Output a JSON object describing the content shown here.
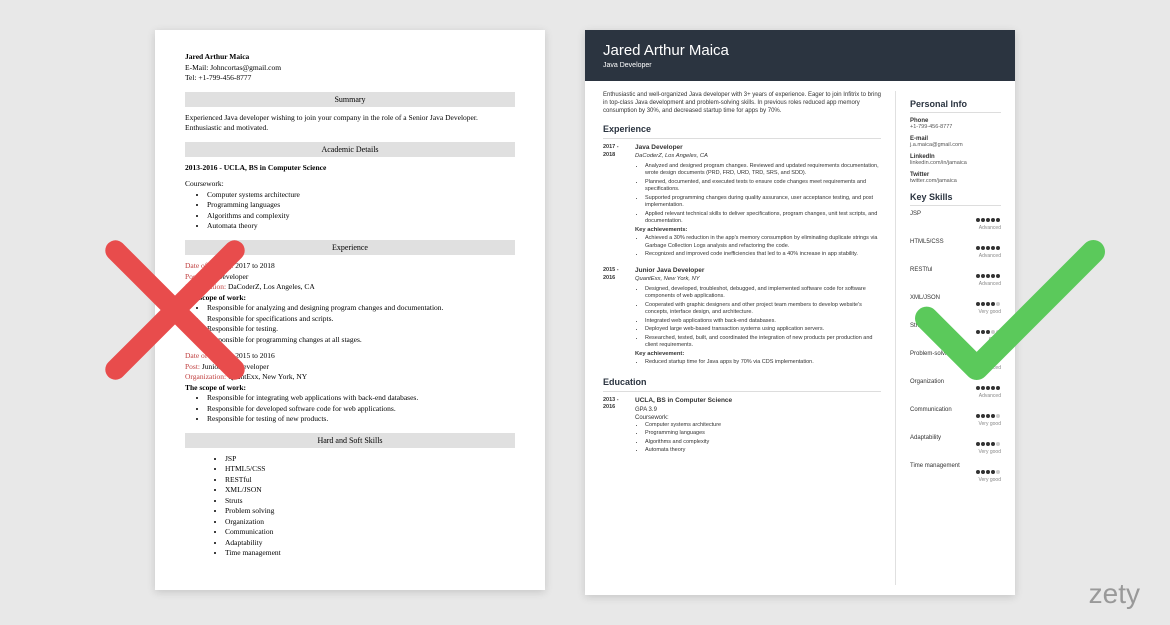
{
  "left": {
    "name": "Jared Arthur Maica",
    "email_lbl": "E-Mail: Johncortas@gmail.com",
    "tel_lbl": "Tel: +1-799-456-8777",
    "s1": "Summary",
    "summary": "Experienced Java developer wishing to join your company in the role of a Senior Java Developer. Enthusiastic and motivated.",
    "s2": "Academic Details",
    "edu": "2013-2016 - UCLA, BS in Computer Science",
    "cw": "Coursework:",
    "courses": [
      "Computer systems architecture",
      "Programming languages",
      "Algorithms and complexity",
      "Automata theory"
    ],
    "s3": "Experience",
    "e1_doj": "Date of Joining:",
    "e1_dates": " 2017 to 2018",
    "e1_post": "Post:",
    "e1_pv": " Java Developer",
    "e1_org": "Organization:",
    "e1_ov": " DaCoderZ, Los Angeles, CA",
    "scope": "The scope of work:",
    "e1_b": [
      "Responsible for analyzing and designing program changes and documentation.",
      "Responsible for specifications and scripts.",
      "Responsible for testing.",
      "Responsible for programming changes at all stages."
    ],
    "e2_doj": "Date of Joining:",
    "e2_dates": " 2015 to 2016",
    "e2_post": "Post:",
    "e2_pv": " Junior Java Developer",
    "e2_org": "Organization:",
    "e2_ov": " QuantExx, New York, NY",
    "e2_b": [
      "Responsible for integrating web applications with back-end databases.",
      "Responsible for developed software code for web applications.",
      "Responsible for testing of new products."
    ],
    "s4": "Hard and Soft Skills",
    "sk": [
      "JSP",
      "HTML5/CSS",
      "RESTful",
      "XML/JSON",
      "Struts",
      "Problem solving",
      "Organization",
      "Communication",
      "Adaptability",
      "Time management"
    ]
  },
  "right": {
    "name": "Jared Arthur Maica",
    "title": "Java Developer",
    "summary": "Enthusiastic and well-organized Java developer with 3+ years of experience. Eager to join Infitrix to bring in top-class Java development and problem-solving skills. In previous roles reduced app memory consumption by 30%, and decreased startup time for apps by 70%.",
    "h_exp": "Experience",
    "h_edu": "Education",
    "h_pi": "Personal Info",
    "h_ks": "Key Skills",
    "jobs": [
      {
        "d1": "2017 -",
        "d2": "2018",
        "title": "Java Developer",
        "org": "DaCoderZ, Los Angeles, CA",
        "bul": [
          "Analyzed and designed program changes. Reviewed and updated requirements documentation, wrote design documents (PRD, FRD, URD, TRD, SRS, and SDD).",
          "Planned, documented, and executed tests to ensure code changes meet requirements and specifications.",
          "Supported programming changes during quality assurance, user acceptance testing, and post implementation.",
          "Applied relevant technical skills to deliver specifications, program changes, unit test scripts, and documentation."
        ],
        "ka": "Key achievements:",
        "ab": [
          "Achieved a 30% reduction in the app's memory consumption by eliminating duplicate strings via Garbage Collection Logs analysis and refactoring the code.",
          "Recognized and improved code inefficiencies that led to a 40% increase in app stability."
        ]
      },
      {
        "d1": "2015 -",
        "d2": "2016",
        "title": "Junior Java Developer",
        "org": "QuantExx, New York, NY",
        "bul": [
          "Designed, developed, troubleshot, debugged, and implemented software code for software components of web applications.",
          "Cooperated with graphic designers and other project team members to develop website's concepts, interface design, and architecture.",
          "Integrated web applications with back-end databases.",
          "Deployed large web-based transaction systems using application servers.",
          "Researched, tested, built, and coordinated the integration of new products per production and client requirements."
        ],
        "ka": "Key achievement:",
        "ab": [
          "Reduced startup time for Java apps by 70% via CDS implementation."
        ]
      }
    ],
    "edu": {
      "d1": "2013 -",
      "d2": "2016",
      "title": "UCLA, BS in Computer Science",
      "gpa": "GPA 3.9",
      "cw": "Coursework:",
      "c": [
        "Computer systems architecture",
        "Programming languages",
        "Algorithms and complexity",
        "Automata theory"
      ]
    },
    "pi": [
      {
        "lbl": "Phone",
        "val": "+1-799-456-8777"
      },
      {
        "lbl": "E-mail",
        "val": "j.a.maica@gmail.com"
      },
      {
        "lbl": "LinkedIn",
        "val": "linkedin.com/in/jamaica"
      },
      {
        "lbl": "Twitter",
        "val": "twitter.com/jamaica"
      }
    ],
    "skills": [
      {
        "n": "JSP",
        "d": 5,
        "l": "Advanced"
      },
      {
        "n": "HTML5/CSS",
        "d": 5,
        "l": "Advanced"
      },
      {
        "n": "RESTful",
        "d": 5,
        "l": "Advanced"
      },
      {
        "n": "XML/JSON",
        "d": 4,
        "l": "Very good"
      },
      {
        "n": "Struts",
        "d": 3,
        "l": "Good"
      },
      {
        "n": "Problem-solving",
        "d": 5,
        "l": "Advanced"
      },
      {
        "n": "Organization",
        "d": 5,
        "l": "Advanced"
      },
      {
        "n": "Communication",
        "d": 4,
        "l": "Very good"
      },
      {
        "n": "Adaptability",
        "d": 4,
        "l": "Very good"
      },
      {
        "n": "Time management",
        "d": 4,
        "l": "Very good"
      }
    ]
  },
  "logo": "zety"
}
